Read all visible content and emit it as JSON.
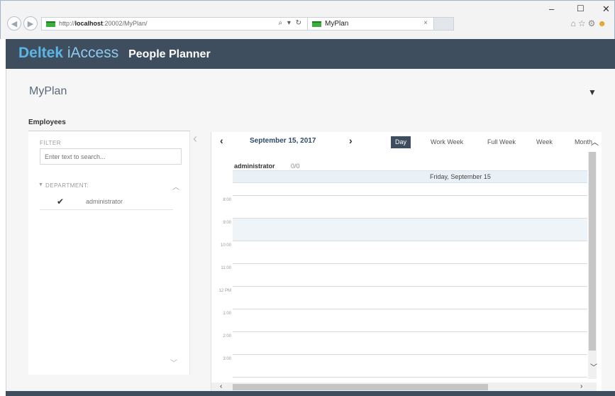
{
  "browser": {
    "url_prefix": "http://",
    "url_host": "localhost",
    "url_path": ":20002/MyPlan/",
    "addr_icons": "⌕ ▾ ↻",
    "tab_title": "MyPlan",
    "tab_close": "×",
    "win_min": "–",
    "win_max": "☐",
    "win_close": "✕",
    "toolbar_icons": {
      "home": "⌂",
      "star": "☆",
      "gear": "⚙",
      "smiley": "☻"
    }
  },
  "header": {
    "brand_deltek": "Deltek",
    "brand_iaccess": "iAccess",
    "brand_product": "People Planner"
  },
  "page": {
    "title": "MyPlan"
  },
  "employees": {
    "title": "Employees",
    "filter_label": "FILTER",
    "search_placeholder": "Enter text to search...",
    "department_label": "DEPARTMENT:",
    "items": [
      {
        "name": "administrator",
        "checked": true
      }
    ]
  },
  "calendar": {
    "date_label": "September 15, 2017",
    "views": [
      "Day",
      "Work Week",
      "Full Week",
      "Week",
      "Month"
    ],
    "active_view": "Day",
    "resource": {
      "name": "administrator",
      "count": "0/0"
    },
    "day_header": "Friday, September 15",
    "hours": [
      "8:00",
      "9:00",
      "10:00",
      "11:00",
      "12 PM",
      "1:00",
      "2:00",
      "3:00"
    ]
  },
  "icons": {
    "back": "back-arrow-icon",
    "forward": "forward-arrow-icon",
    "filter": "filter-icon",
    "prev": "chevron-left-icon",
    "next": "chevron-right-icon"
  },
  "colors": {
    "header_bg": "#3e4e5e",
    "brand_blue": "#5bb6e6",
    "active_view_bg": "#3e4e5e"
  }
}
